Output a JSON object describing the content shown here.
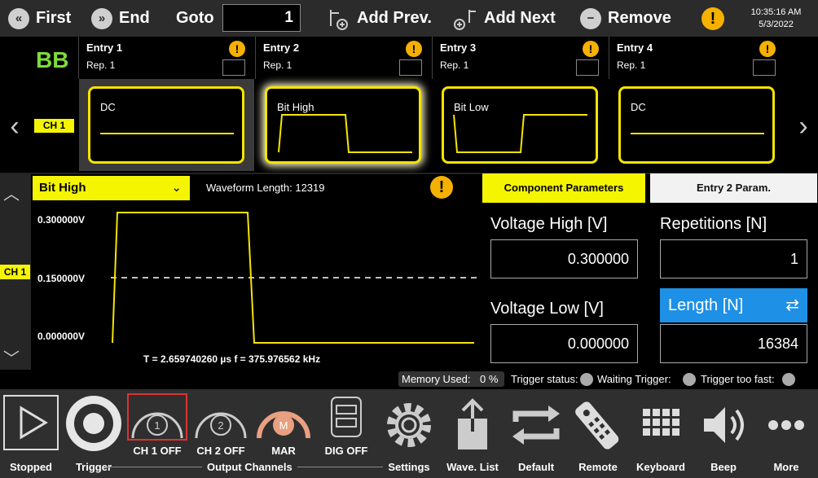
{
  "toolbar": {
    "first": "First",
    "end": "End",
    "goto_label": "Goto",
    "goto_value": "1",
    "add_prev": "Add Prev.",
    "add_next": "Add Next",
    "remove": "Remove",
    "time": "10:35:16 AM",
    "date": "5/3/2022"
  },
  "sequence": {
    "badge": "BB",
    "channel": "CH 1",
    "entries": [
      {
        "title": "Entry  1",
        "rep": "Rep.  1",
        "wave": "DC"
      },
      {
        "title": "Entry  2",
        "rep": "Rep.  1",
        "wave": "Bit High"
      },
      {
        "title": "Entry  3",
        "rep": "Rep.  1",
        "wave": "Bit Low"
      },
      {
        "title": "Entry  4",
        "rep": "Rep.  1",
        "wave": "DC"
      }
    ]
  },
  "editor": {
    "waveform": "Bit High",
    "waveform_length": "Waveform Length:  12319",
    "channel": "CH 1",
    "y_labels": [
      "0.300000V",
      "0.150000V",
      "0.000000V"
    ],
    "timing": "T  =  2.659740260 µs   f  =  375.976562 kHz",
    "tab_component": "Component Parameters",
    "tab_entry": "Entry  2  Param.",
    "voltage_high_label": "Voltage High [V]",
    "voltage_high": "0.300000",
    "voltage_low_label": "Voltage Low [V]",
    "voltage_low": "0.000000",
    "repetitions_label": "Repetitions [N]",
    "repetitions": "1",
    "length_label": "Length [N]",
    "length": "16384"
  },
  "status": {
    "memory_label": "Memory Used:",
    "memory_value": "0 %",
    "trigger_status": "Trigger status:",
    "waiting": "Waiting Trigger:",
    "too_fast": "Trigger too fast:"
  },
  "bottom": {
    "stopped": "Stopped",
    "trigger": "Trigger",
    "ch1": "CH 1 OFF",
    "ch2": "CH 2 OFF",
    "mar": "MAR",
    "dig": "DIG OFF",
    "output_channels": "Output Channels",
    "settings": "Settings",
    "wave_list": "Wave. List",
    "default": "Default",
    "remote": "Remote",
    "keyboard": "Keyboard",
    "beep": "Beep",
    "more": "More"
  },
  "colors": {
    "accent_yellow": "#f5e400",
    "blue": "#1e90e6",
    "warn": "#f5b000"
  }
}
